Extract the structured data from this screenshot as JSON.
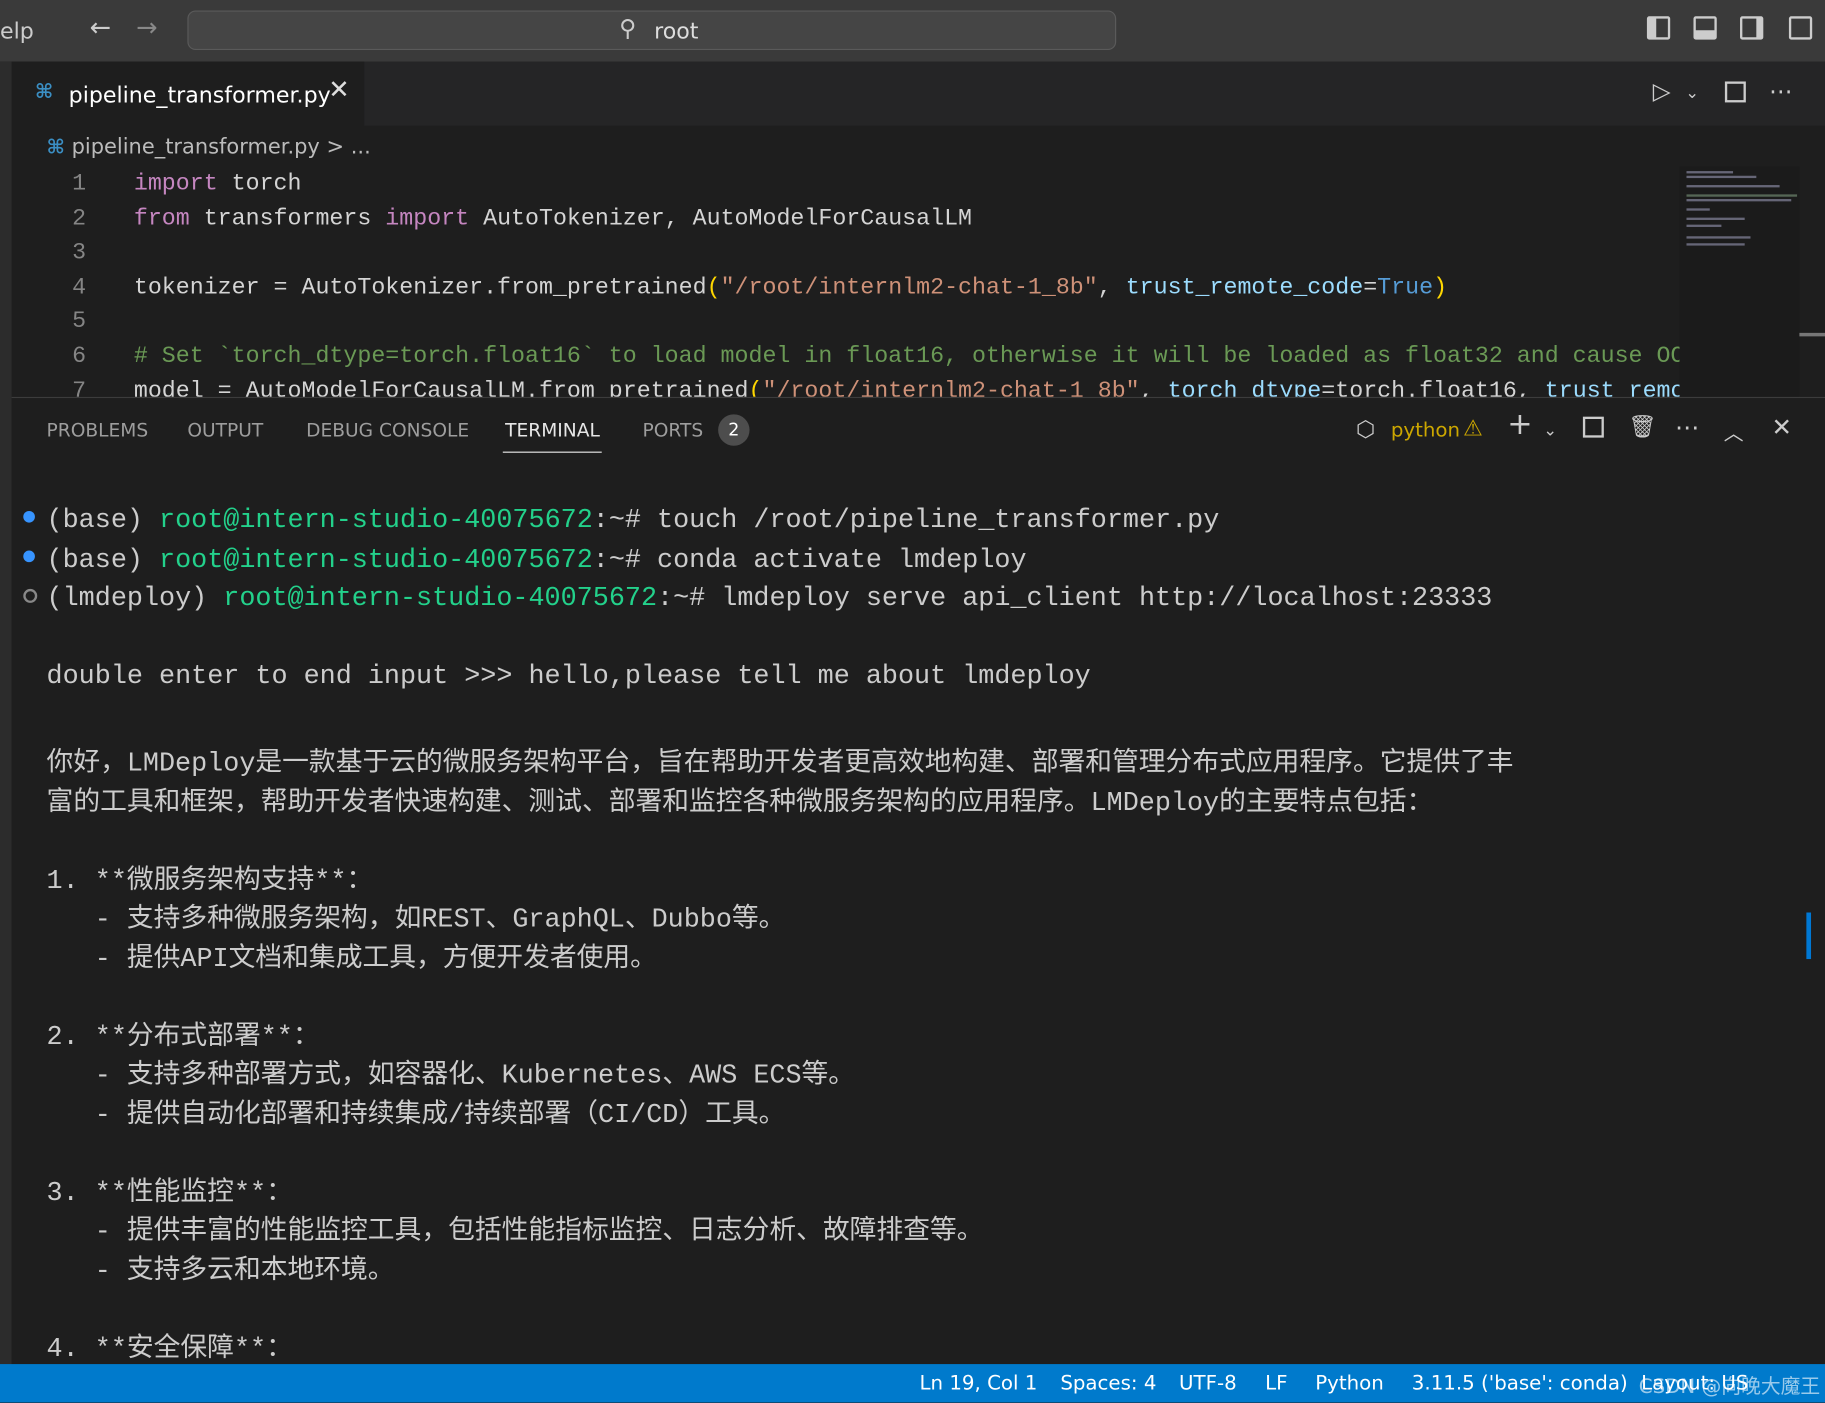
{
  "titlebar": {
    "menu_partial": "elp",
    "search_text": "root",
    "back_icon": "←",
    "forward_icon": "→"
  },
  "tab": {
    "label": "pipeline_transformer.py",
    "close": "✕"
  },
  "breadcrumb": {
    "file": "pipeline_transformer.py",
    "sep": ">",
    "more": "..."
  },
  "code": [
    {
      "n": "1",
      "tokens": [
        [
          "import",
          "k"
        ],
        [
          " torch",
          "f"
        ]
      ]
    },
    {
      "n": "2",
      "tokens": [
        [
          "from",
          "k"
        ],
        [
          " transformers ",
          "f"
        ],
        [
          "import",
          "k"
        ],
        [
          " AutoTokenizer, AutoModelForCausalLM",
          "f"
        ]
      ]
    },
    {
      "n": "3",
      "tokens": []
    },
    {
      "n": "4",
      "tokens": [
        [
          "tokenizer = AutoTokenizer.from_pretrained",
          "f"
        ],
        [
          "(",
          "y"
        ],
        [
          "\"/root/internlm2-chat-1_8b\"",
          "s"
        ],
        [
          ", ",
          "f"
        ],
        [
          "trust_remote_code",
          "p"
        ],
        [
          "=",
          "f"
        ],
        [
          "True",
          "b"
        ],
        [
          ")",
          "y"
        ]
      ]
    },
    {
      "n": "5",
      "tokens": []
    },
    {
      "n": "6",
      "tokens": [
        [
          "# Set `torch_dtype=torch.float16` to load model in float16, otherwise it will be loaded as float32 and cause OOM",
          "c"
        ]
      ]
    },
    {
      "n": "7",
      "tokens": [
        [
          "model = AutoModelForCausalLM.from_pretrained",
          "f"
        ],
        [
          "(",
          "y"
        ],
        [
          "\"/root/internlm2-chat-1_8b\"",
          "s"
        ],
        [
          ", ",
          "f"
        ],
        [
          "torch_dtype",
          "p"
        ],
        [
          "=torch.float16, ",
          "f"
        ],
        [
          "trust_remote_code",
          "p"
        ]
      ]
    }
  ],
  "panel": {
    "tabs": [
      "PROBLEMS",
      "OUTPUT",
      "DEBUG CONSOLE",
      "TERMINAL",
      "PORTS"
    ],
    "ports_count": "2",
    "terminal_name": "python"
  },
  "terminal": [
    {
      "dot": "blue",
      "parts": [
        [
          "(base) ",
          "t"
        ],
        [
          "root@intern-studio-40075672",
          "g"
        ],
        [
          ":~# touch /root/pipeline_transformer.py",
          "t"
        ]
      ]
    },
    {
      "dot": "blue",
      "parts": [
        [
          "(base) ",
          "t"
        ],
        [
          "root@intern-studio-40075672",
          "g"
        ],
        [
          ":~# conda activate lmdeploy",
          "t"
        ]
      ]
    },
    {
      "dot": "hollow",
      "parts": [
        [
          "(lmdeploy) ",
          "t"
        ],
        [
          "root@intern-studio-40075672",
          "g"
        ],
        [
          ":~# lmdeploy serve api_client http://localhost:23333",
          "t"
        ]
      ]
    },
    {
      "parts": []
    },
    {
      "parts": [
        [
          "double enter to end input >>> hello,please tell me about lmdeploy",
          "t"
        ]
      ]
    },
    {
      "parts": []
    },
    {
      "parts": [
        [
          "你好，LMDeploy是一款基于云的微服务架构平台，旨在帮助开发者更高效地构建、部署和管理分布式应用程序。它提供了丰",
          "t"
        ]
      ]
    },
    {
      "parts": [
        [
          "富的工具和框架，帮助开发者快速构建、测试、部署和监控各种微服务架构的应用程序。LMDeploy的主要特点包括：",
          "t"
        ]
      ]
    },
    {
      "parts": []
    },
    {
      "parts": [
        [
          "1. **微服务架构支持**：",
          "t"
        ]
      ]
    },
    {
      "parts": [
        [
          "   - 支持多种微服务架构，如REST、GraphQL、Dubbo等。",
          "t"
        ]
      ]
    },
    {
      "parts": [
        [
          "   - 提供API文档和集成工具，方便开发者使用。",
          "t"
        ]
      ]
    },
    {
      "parts": []
    },
    {
      "parts": [
        [
          "2. **分布式部署**：",
          "t"
        ]
      ]
    },
    {
      "parts": [
        [
          "   - 支持多种部署方式，如容器化、Kubernetes、AWS ECS等。",
          "t"
        ]
      ]
    },
    {
      "parts": [
        [
          "   - 提供自动化部署和持续集成/持续部署（CI/CD）工具。",
          "t"
        ]
      ]
    },
    {
      "parts": []
    },
    {
      "parts": [
        [
          "3. **性能监控**：",
          "t"
        ]
      ]
    },
    {
      "parts": [
        [
          "   - 提供丰富的性能监控工具，包括性能指标监控、日志分析、故障排查等。",
          "t"
        ]
      ]
    },
    {
      "parts": [
        [
          "   - 支持多云和本地环境。",
          "t"
        ]
      ]
    },
    {
      "parts": []
    },
    {
      "parts": [
        [
          "4. **安全保障**：",
          "t"
        ]
      ]
    }
  ],
  "statusbar": {
    "position": "Ln 19, Col 1",
    "spaces": "Spaces: 4",
    "encoding": "UTF-8",
    "eol": "LF",
    "language": "Python",
    "interpreter": "3.11.5 ('base': conda)",
    "layout": "Layout: US",
    "watermark": "CSDN @向晚大魔王"
  },
  "colors": {
    "statusbar": "#007acc",
    "prompt_green": "#23d18b",
    "dot_blue": "#3794ff"
  }
}
